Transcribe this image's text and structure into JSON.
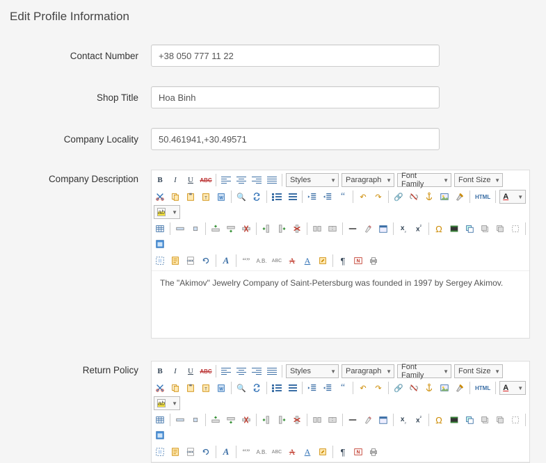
{
  "page_title": "Edit Profile Information",
  "fields": {
    "contact_number": {
      "label": "Contact Number",
      "value": "+38 050 777 11 22"
    },
    "shop_title": {
      "label": "Shop Title",
      "value": "Hoa Binh"
    },
    "company_locality": {
      "label": "Company Locality",
      "value": "50.461941,+30.49571"
    },
    "company_description": {
      "label": "Company Description",
      "content": "The \"Akimov\" Jewelry Company of Saint-Petersburg was founded in 1997 by Sergey Akimov."
    },
    "return_policy": {
      "label": "Return Policy",
      "content": ""
    }
  },
  "editor": {
    "dropdowns": {
      "styles": "Styles",
      "paragraph": "Paragraph",
      "font_family": "Font Family",
      "font_size": "Font Size"
    },
    "color_label": "A",
    "highlight_label": "ab",
    "html_label": "HTML"
  }
}
